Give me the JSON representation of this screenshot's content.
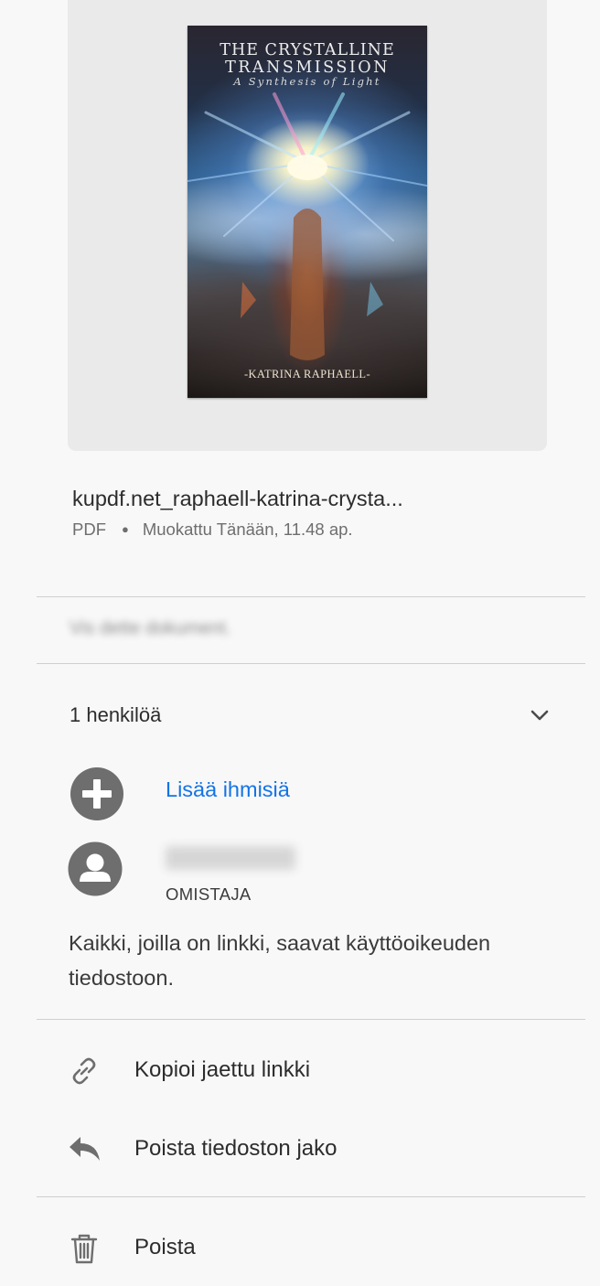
{
  "thumbnail": {
    "cover_title_line1": "THE CRYSTALLINE",
    "cover_title_line2": "TRANSMISSION",
    "cover_subtitle": "A Synthesis of Light",
    "cover_author": "-KATRINA RAPHAELL-"
  },
  "file": {
    "name": "kupdf.net_raphaell-katrina-crysta...",
    "type": "PDF",
    "modified": "Muokattu Tänään, 11.48 ap."
  },
  "blurred_message": "Vis dette dokument.",
  "people": {
    "count_label": "1 henkilöä",
    "add_label": "Lisää ihmisiä",
    "owner_role": "OMISTAJA"
  },
  "link_note": "Kaikki, joilla on linkki, saavat käyttöoikeuden tiedostoon.",
  "actions": {
    "copy_link": "Kopioi jaettu linkki",
    "unshare": "Poista tiedoston jako",
    "delete": "Poista"
  },
  "colors": {
    "accent": "#1473e6",
    "icon_gray": "#6e6e6e",
    "background": "#f8f8f8"
  },
  "icons": [
    "chevron-down-icon",
    "add-circle-icon",
    "user-avatar-icon",
    "link-icon",
    "reply-arrow-icon",
    "trash-icon"
  ]
}
